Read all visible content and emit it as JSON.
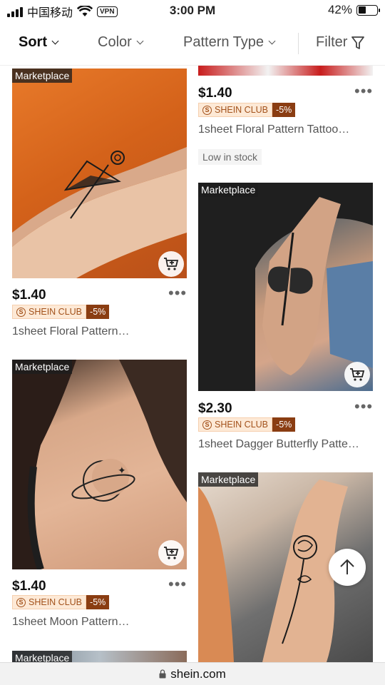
{
  "status_bar": {
    "carrier": "中国移动",
    "vpn": "VPN",
    "time": "3:00 PM",
    "battery": "42%",
    "battery_level": 0.42
  },
  "filter_bar": {
    "sort": "Sort",
    "color": "Color",
    "pattern_type": "Pattern Type",
    "filter": "Filter"
  },
  "products": [
    {
      "badge": "Marketplace",
      "price": "$1.40",
      "club": "SHEIN CLUB",
      "discount": "-5%",
      "name": "1sheet Floral Pattern…"
    },
    {
      "badge": "Marketplace",
      "price": "$1.40",
      "club": "SHEIN CLUB",
      "discount": "-5%",
      "name": "1sheet Moon Pattern…"
    },
    {
      "badge": "Marketplace"
    },
    {
      "price": "$1.40",
      "club": "SHEIN CLUB",
      "discount": "-5%",
      "name": "1sheet Floral Pattern Tattoo…",
      "stock": "Low in stock"
    },
    {
      "badge": "Marketplace",
      "price": "$2.30",
      "club": "SHEIN CLUB",
      "discount": "-5%",
      "name": "1sheet Dagger Butterfly Patte…"
    },
    {
      "badge": "Marketplace"
    }
  ],
  "more_label": "•••",
  "url": "shein.com",
  "colors": {
    "club_bg": "#fde9d6",
    "club_text": "#a3521c",
    "discount_bg": "#8a3d12"
  }
}
